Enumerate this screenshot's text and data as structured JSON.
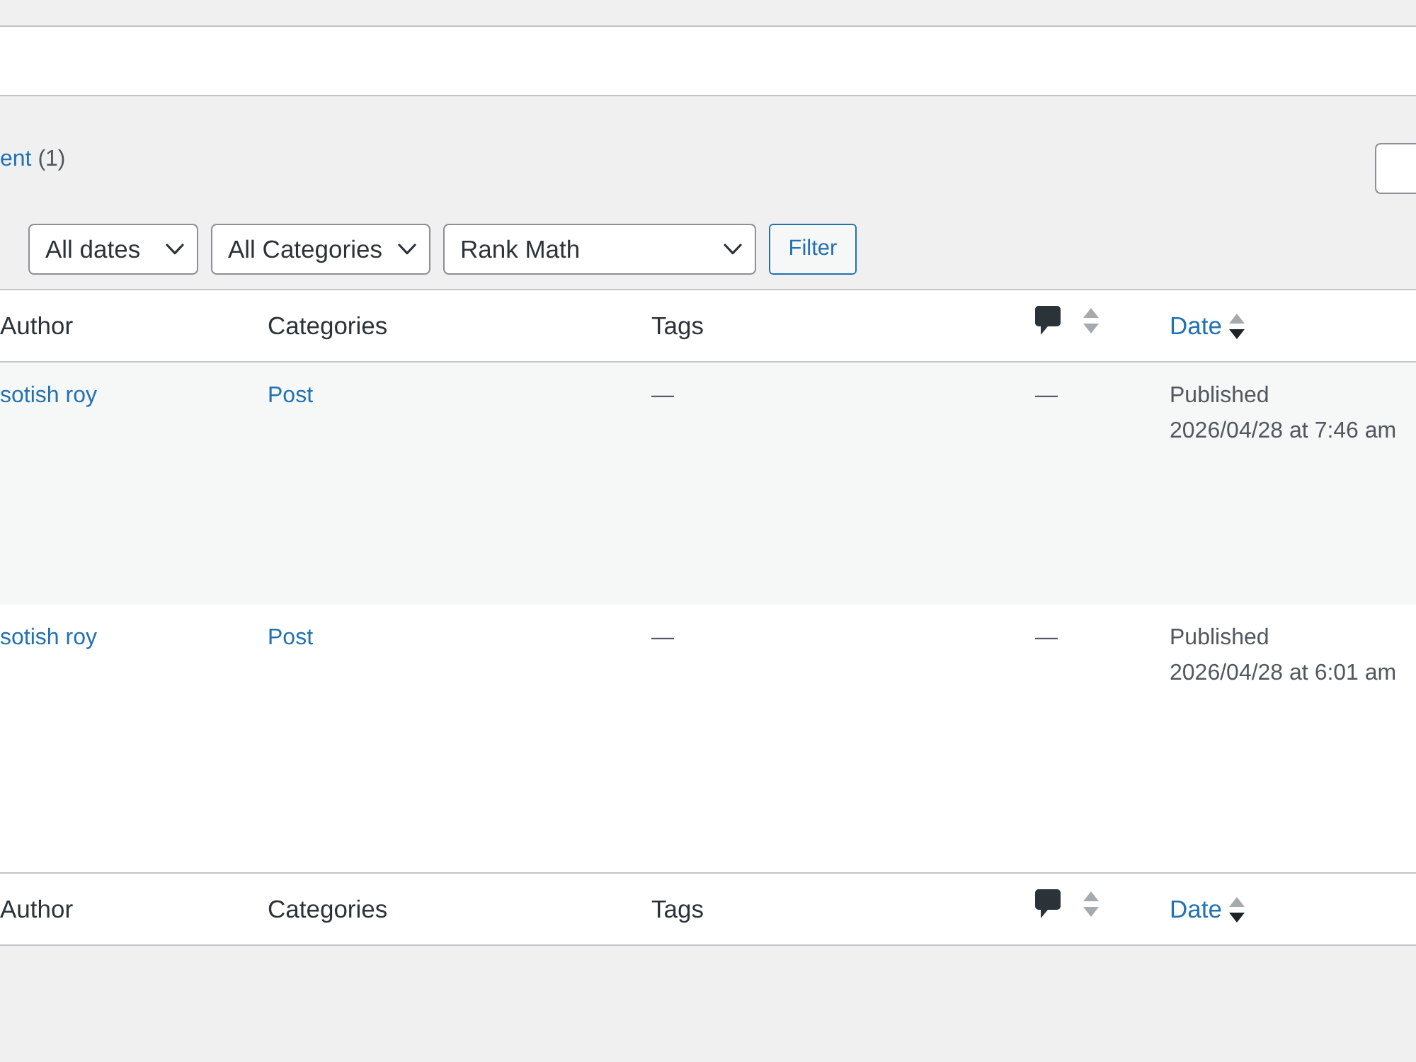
{
  "views": [
    {
      "label": "ent",
      "count": "(1)"
    }
  ],
  "filters": [
    {
      "kind": "dropdown",
      "value": "All dates"
    },
    {
      "kind": "dropdown",
      "value": "All Categories"
    },
    {
      "kind": "dropdown",
      "value": "Rank Math"
    },
    {
      "kind": "button",
      "label": "Filter"
    }
  ],
  "table": {
    "columns": [
      {
        "kind": "text",
        "label": "Author",
        "sortable": false
      },
      {
        "kind": "text",
        "label": "Categories",
        "sortable": false
      },
      {
        "kind": "text",
        "label": "Tags",
        "sortable": false
      },
      {
        "kind": "comments",
        "sortable": true,
        "sorted": false
      },
      {
        "kind": "text",
        "label": "Date",
        "sortable": true,
        "sorted": true
      }
    ],
    "rows": [
      {
        "author": "sotish roy",
        "categories": "Post",
        "tags": "—",
        "comments": "—",
        "status": "Published",
        "datetime": "2026/04/28 at 7:46 am"
      },
      {
        "author": "sotish roy",
        "categories": "Post",
        "tags": "—",
        "comments": "—",
        "status": "Published",
        "datetime": "2026/04/28 at 6:01 am"
      }
    ],
    "footer_columns": [
      {
        "kind": "text",
        "label": "Author",
        "sortable": false
      },
      {
        "kind": "text",
        "label": "Categories",
        "sortable": false
      },
      {
        "kind": "text",
        "label": "Tags",
        "sortable": false
      },
      {
        "kind": "comments",
        "sortable": true,
        "sorted": false
      },
      {
        "kind": "text",
        "label": "Date",
        "sortable": true,
        "sorted": true
      }
    ]
  }
}
